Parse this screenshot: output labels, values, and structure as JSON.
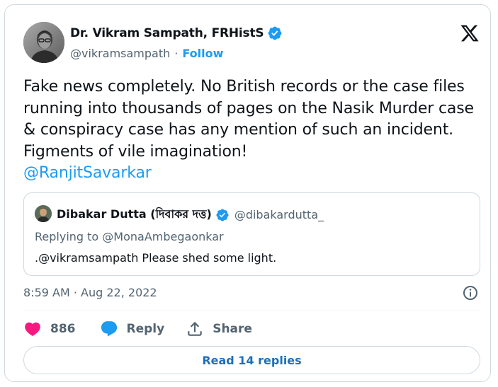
{
  "author": {
    "display_name": "Dr. Vikram Sampath, FRHistS",
    "handle": "@vikramsampath",
    "separator": "·",
    "follow_label": "Follow",
    "verified": true
  },
  "tweet": {
    "text": "Fake news completely. No British records or the case files running into thousands of pages on the Nasik Murder case & conspiracy case has any mention of such an incident. Figments of vile imagination!",
    "mention": "@RanjitSavarkar",
    "timestamp": "8:59 AM · Aug 22, 2022"
  },
  "quoted_tweet": {
    "display_name": "Dibakar Dutta (দিবাকর দত্ত)",
    "handle": "@dibakardutta_",
    "replying_to": "Replying to @MonaAmbegaonkar",
    "text": ".@vikramsampath Please shed some light.",
    "verified": true
  },
  "actions": {
    "likes": "886",
    "reply_label": "Reply",
    "share_label": "Share"
  },
  "read_replies_label": "Read 14 replies",
  "colors": {
    "accent": "#1d9bf0",
    "heart": "#f91880",
    "muted": "#536471",
    "border": "#cfd9de"
  },
  "icons": {
    "logo": "x-logo-icon",
    "verified": "verified-badge-icon",
    "info": "info-icon",
    "like": "heart-icon",
    "reply": "reply-bubble-icon",
    "share": "share-upload-icon"
  }
}
